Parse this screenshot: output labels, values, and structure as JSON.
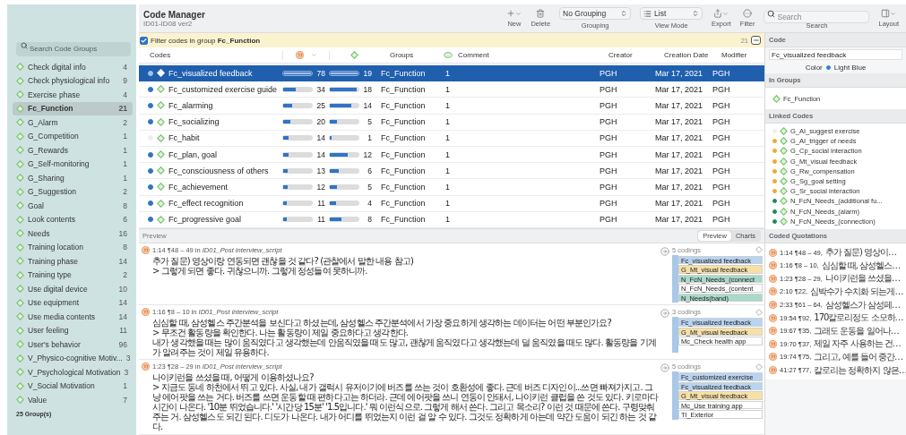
{
  "app": {
    "title": "Code Manager",
    "subtitle": "ID01-ID08 ver2"
  },
  "toolbar": [
    {
      "kind": "add",
      "label": "New"
    },
    {
      "kind": "delete",
      "label": "Delete"
    },
    {
      "kind": "select",
      "label": "Grouping",
      "value": "No Grouping"
    },
    {
      "kind": "viewselect",
      "label": "View Mode",
      "value": "List"
    },
    {
      "kind": "export",
      "label": "Export"
    },
    {
      "kind": "filter",
      "label": "Filter"
    },
    {
      "kind": "search",
      "label": "Search",
      "placeholder": "Search"
    },
    {
      "kind": "layout",
      "label": "Layout"
    }
  ],
  "sidebar": {
    "search_placeholder": "Search Code Groups",
    "groups": [
      {
        "name": "Check digital info",
        "count": "4",
        "selected": false
      },
      {
        "name": "Check physiological info",
        "count": "9",
        "selected": false
      },
      {
        "name": "Exercise phase",
        "count": "4",
        "selected": false
      },
      {
        "name": "Fc_Function",
        "count": "21",
        "selected": true
      },
      {
        "name": "G_Alarm",
        "count": "2",
        "selected": false
      },
      {
        "name": "G_Competition",
        "count": "1",
        "selected": false
      },
      {
        "name": "G_Rewards",
        "count": "1",
        "selected": false
      },
      {
        "name": "G_Self-monitoring",
        "count": "1",
        "selected": false
      },
      {
        "name": "G_Sharing",
        "count": "1",
        "selected": false
      },
      {
        "name": "G_Suggestion",
        "count": "2",
        "selected": false
      },
      {
        "name": "Goal",
        "count": "8",
        "selected": false
      },
      {
        "name": "Look contents",
        "count": "6",
        "selected": false
      },
      {
        "name": "Needs",
        "count": "16",
        "selected": false
      },
      {
        "name": "Training location",
        "count": "8",
        "selected": false
      },
      {
        "name": "Training phase",
        "count": "14",
        "selected": false
      },
      {
        "name": "Training type",
        "count": "2",
        "selected": false
      },
      {
        "name": "Use digital device",
        "count": "10",
        "selected": false
      },
      {
        "name": "Use equipment",
        "count": "14",
        "selected": false
      },
      {
        "name": "Use media contents",
        "count": "14",
        "selected": false
      },
      {
        "name": "User feeling",
        "count": "11",
        "selected": false
      },
      {
        "name": "User's behavior",
        "count": "96",
        "selected": false
      },
      {
        "name": "V_Physico-cognitive Motiv...",
        "count": "3",
        "selected": false
      },
      {
        "name": "V_Psychological Motivation",
        "count": "3",
        "selected": false
      },
      {
        "name": "V_Social Motivation",
        "count": "1",
        "selected": false
      },
      {
        "name": "Value",
        "count": "7",
        "selected": false
      }
    ],
    "footer": "25 Group(s)"
  },
  "filter_bar": {
    "checked": true,
    "text": "Filter codes in group **Fc_Function**",
    "count": "21"
  },
  "table": {
    "columns": [
      {
        "kind": "text",
        "label": "Codes",
        "sorted": false
      },
      {
        "kind": "quotations",
        "sorted": true
      },
      {
        "kind": "density",
        "sorted": false
      },
      {
        "kind": "text",
        "label": "Groups",
        "sorted": false
      },
      {
        "kind": "comment",
        "label": "Comment",
        "sorted": false
      },
      {
        "kind": "text",
        "label": "Creator",
        "sorted": false
      },
      {
        "kind": "text",
        "label": "Creation Date",
        "sorted": false
      },
      {
        "kind": "text",
        "label": "Modifier",
        "sorted": false
      }
    ],
    "rows": [
      {
        "name": "Fc_visualized feedback",
        "color": "#9cc3f0",
        "selected": true,
        "quotations": {
          "value": "78",
          "level": 1
        },
        "density": {
          "value": "19",
          "level": 1
        },
        "group": "Fc_Function",
        "comment": "1",
        "creator": "PGH",
        "date": "Mar 17, 2021",
        "modifier": "PGH"
      },
      {
        "name": "Fc_customized exercise guide",
        "color": "#2f74c8",
        "selected": false,
        "quotations": {
          "value": "34",
          "level": 0.44
        },
        "density": {
          "value": "18",
          "level": 0.95
        },
        "group": "Fc_Function",
        "comment": "1",
        "creator": "PGH",
        "date": "Mar 17, 2021",
        "modifier": "PGH"
      },
      {
        "name": "Fc_alarming",
        "color": "#2f74c8",
        "selected": false,
        "quotations": {
          "value": "25",
          "level": 0.32
        },
        "density": {
          "value": "14",
          "level": 0.74
        },
        "group": "Fc_Function",
        "comment": "1",
        "creator": "PGH",
        "date": "Mar 17, 2021",
        "modifier": "PGH"
      },
      {
        "name": "Fc_socializing",
        "color": "#2f74c8",
        "selected": false,
        "quotations": {
          "value": "20",
          "level": 0.26
        },
        "density": {
          "value": "5",
          "level": 0.26
        },
        "group": "Fc_Function",
        "comment": "1",
        "creator": "PGH",
        "date": "Mar 17, 2021",
        "modifier": "PGH"
      },
      {
        "name": "Fc_habit",
        "color": "#eeeeee",
        "selected": false,
        "quotations": {
          "value": "14",
          "level": 0.18
        },
        "density": {
          "value": "1",
          "level": 0.05
        },
        "group": "Fc_Function",
        "comment": "1",
        "creator": "PGH",
        "date": "Mar 17, 2021",
        "modifier": "PGH"
      },
      {
        "name": "Fc_plan, goal",
        "color": "#2f74c8",
        "selected": false,
        "quotations": {
          "value": "14",
          "level": 0.18
        },
        "density": {
          "value": "12",
          "level": 0.63
        },
        "group": "Fc_Function",
        "comment": "1",
        "creator": "PGH",
        "date": "Mar 17, 2021",
        "modifier": "PGH"
      },
      {
        "name": "Fc_consciousness of others",
        "color": "#2f74c8",
        "selected": false,
        "quotations": {
          "value": "13",
          "level": 0.17
        },
        "density": {
          "value": "6",
          "level": 0.32
        },
        "group": "Fc_Function",
        "comment": "1",
        "creator": "PGH",
        "date": "Mar 17, 2021",
        "modifier": "PGH"
      },
      {
        "name": "Fc_achievement",
        "color": "#2f74c8",
        "selected": false,
        "quotations": {
          "value": "12",
          "level": 0.15
        },
        "density": {
          "value": "5",
          "level": 0.26
        },
        "group": "Fc_Function",
        "comment": "1",
        "creator": "PGH",
        "date": "Mar 17, 2021",
        "modifier": "PGH"
      },
      {
        "name": "Fc_effect recognition",
        "color": "#2f74c8",
        "selected": false,
        "quotations": {
          "value": "11",
          "level": 0.14
        },
        "density": {
          "value": "4",
          "level": 0.21
        },
        "group": "Fc_Function",
        "comment": "1",
        "creator": "PGH",
        "date": "Mar 17, 2021",
        "modifier": "PGH"
      },
      {
        "name": "Fc_progressive goal",
        "color": "#2f74c8",
        "selected": false,
        "quotations": {
          "value": "11",
          "level": 0.14
        },
        "density": {
          "value": "8",
          "level": 0.42
        },
        "group": "Fc_Function",
        "comment": "1",
        "creator": "PGH",
        "date": "Mar 17, 2021",
        "modifier": "PGH"
      }
    ]
  },
  "preview": {
    "title": "Preview",
    "tabs": [
      {
        "label": "Preview",
        "selected": true
      },
      {
        "label": "Charts",
        "selected": false
      }
    ],
    "items": [
      {
        "header": "1:14 ¶48 – 49 in *ID01_Post interview_script*",
        "lines": [
          "추가 질문) 영상이랑 연동되면 괜찮을 것 같다? (관찰에서 말한 내용 참고)",
          "> 그렇게 되면 좋다. 귀찮으니까. 그렇게 정성들여 못하니까."
        ],
        "codings_count": "5 codings",
        "codings": [
          {
            "name": "Fc_visualized feedback",
            "color": "#b9d4f0"
          },
          {
            "name": "G_Mt_visual feedback",
            "color": "#f7e0a6"
          },
          {
            "name": "N_FcN_Needs_(connect",
            "color": "#a9d9c9"
          },
          {
            "name": "N_FcN_Needs_(content",
            "color": "#ffffff"
          },
          {
            "name": "N_Needs(band)",
            "color": "#a9d9c9"
          }
        ]
      },
      {
        "header": "1:16 ¶8 – 10 in *ID01_Post interview_script*",
        "lines": [
          "심심할 때, 삼성헬스 주간분석을 보신다고 하셨는데, 삼성헬스 주간분석에서 가장 중요하게 생각하는 데이터는 어떤 부분인가요?",
          "> 무조건 활동량을 확인한다. 나는 활동량이 제일 중요하다고 생각한다.",
          "내가 생각했을 때는 많이 움직였다고 생각했는데 안움직였을 때도 많고, 괜찮게 움직였다고 생각했는데 덜 움직였을 때도 많다. 활동량을 기계가 알려주는 것이 제일 유용하다."
        ],
        "codings_count": "3 codings",
        "codings": [
          {
            "name": "Fc_visualized feedback",
            "color": "#b9d4f0"
          },
          {
            "name": "G_Mt_visual feedback",
            "color": "#f7e0a6"
          },
          {
            "name": "Mc_Check health app",
            "color": "#ffffff"
          }
        ]
      },
      {
        "header": "1:23 ¶28 – 29 in *ID01_Post interview_script*",
        "lines": [
          "나이키런을 쓰셨을 때, 어떻게 이용하셨나요?",
          "> 지금도 동네 하천에서 뛰고 있다. 사실, 내가 갤럭시 유저이기에 버즈를 쓰는 것이 호환성에 좋다. 근데 버즈 디자인이...쓰면 빠져가지고. 그냥 에어팟을 쓰는 거다. 버즈를 쓰면 운동할 때 편하다고는 하더라. 근데 에어팟을 쓰니 연동이 안돼서, 나이키런 클럽을 쓴 것도 있다. 키로마다 시간이 나온다. '10분 뛰었습니다.' '시간당 15분' '1.5입니다.' 뭐 이런식으로. 그렇게 해서 쓴다. 그리고 목소리? 이런 것 때문에 쓴다. 구령맞춰주는 거. 삼성헬스도 되긴 된다. 디도가 나온다. 내가 어디를 뛰었는지 이런 걸 알 수 있다. 그것도 정확하게 아는데 약간 도움이 되긴 하는 것 같다."
        ],
        "codings_count": "5 codings",
        "codings": [
          {
            "name": "Fc_customized exercise",
            "color": "#b9d4f0"
          },
          {
            "name": "Fc_visualized feedback",
            "color": "#b9d4f0"
          },
          {
            "name": "G_Mt_visual feedback",
            "color": "#f7e0a6"
          },
          {
            "name": "Mc_Use training app",
            "color": "#ffffff"
          },
          {
            "name": "Tl_Exterior",
            "color": "#ffffff"
          }
        ]
      }
    ]
  },
  "inspector": {
    "code_header": "Code",
    "code_name": "Fc_visualized feedback",
    "color_label": "Color",
    "color_name": "Light Blue",
    "color": "#2f7fd6",
    "in_groups_header": "In Groups",
    "groups": [
      "Fc_Function"
    ],
    "linked_header": "Linked Codes",
    "linked_codes": [
      {
        "name": "G_AI_suggest exercise",
        "color": "#eeeeee"
      },
      {
        "name": "G_AI_trigger of needs",
        "color": "#f0a830"
      },
      {
        "name": "G_Cp_social interaction",
        "color": "#f0a830"
      },
      {
        "name": "G_Mt_visual feedback",
        "color": "#f0a830"
      },
      {
        "name": "G_Rw_compensation",
        "color": "#f0a830"
      },
      {
        "name": "G_Sg_goal setting",
        "color": "#f0a830"
      },
      {
        "name": "G_Sr_social interaction",
        "color": "#f0a830"
      },
      {
        "name": "N_FcN_Needs_(additional fu...",
        "color": "#1f8a5a"
      },
      {
        "name": "N_FcN_Needs_(alarm)",
        "color": "#1f8a5a"
      },
      {
        "name": "N_FcN_Needs_(connection)",
        "color": "#1f8a5a"
      }
    ],
    "quotations_header": "Coded Quotations",
    "quotations": [
      {
        "ref": "1:14 ¶48 – 49,",
        "text": "추가 질문) 영상이…"
      },
      {
        "ref": "1:16 ¶8 – 10,",
        "text": "심심할 때, 삼성헬스…"
      },
      {
        "ref": "1:23 ¶28 – 29,",
        "text": "나이키런을 쓰셨을…"
      },
      {
        "ref": "2:10 ¶22,",
        "text": "심박수가 수치화 되는게…"
      },
      {
        "ref": "2:33 ¶61 – 64,",
        "text": "삼성헬스가 삼성페…"
      },
      {
        "ref": "19:54 ¶92,",
        "text": "170칼로리정도 소모하…"
      },
      {
        "ref": "19:67 ¶35,",
        "text": "그래도 운동을 일어나…"
      },
      {
        "ref": "19:70 ¶37,",
        "text": "제일 자주 사용하는 건…"
      },
      {
        "ref": "19:74 ¶75,",
        "text": "그리고, 예를 들어 중간…"
      },
      {
        "ref": "41:27 ¶77,",
        "text": "칼로리는 정확하지 않은…"
      }
    ]
  }
}
